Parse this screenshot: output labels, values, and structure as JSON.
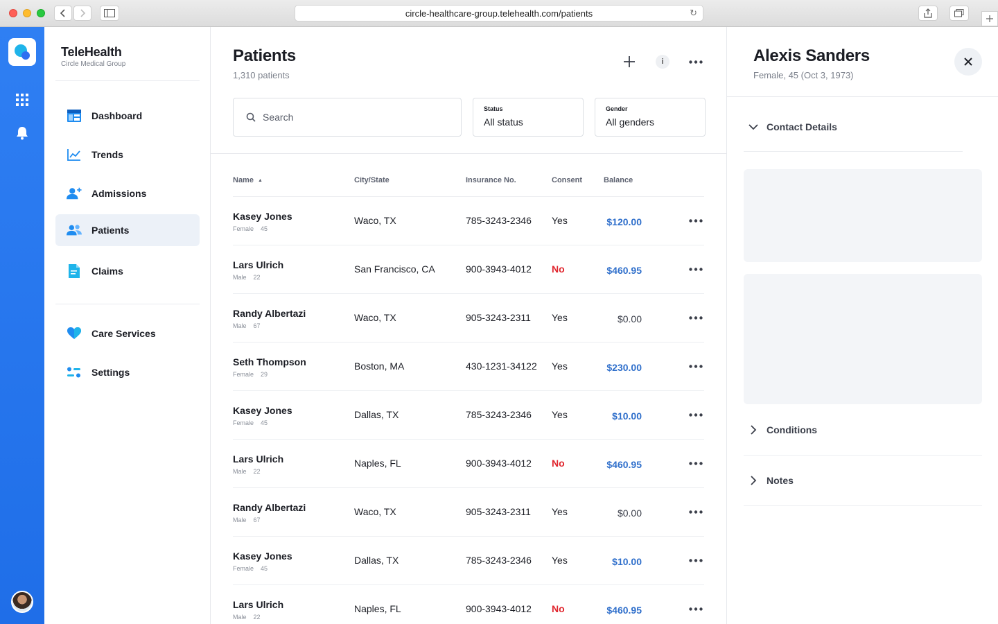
{
  "browser": {
    "url": "circle-healthcare-group.telehealth.com/patients"
  },
  "brand": {
    "title": "TeleHealth",
    "subtitle": "Circle Medical Group"
  },
  "nav": {
    "primary": [
      {
        "label": "Dashboard",
        "icon": "dashboard-icon"
      },
      {
        "label": "Trends",
        "icon": "trends-icon"
      },
      {
        "label": "Admissions",
        "icon": "add-user-icon"
      },
      {
        "label": "Patients",
        "icon": "patients-icon",
        "active": true
      },
      {
        "label": "Claims",
        "icon": "document-icon"
      }
    ],
    "secondary": [
      {
        "label": "Care Services",
        "icon": "heart-icon"
      },
      {
        "label": "Settings",
        "icon": "settings-icon"
      }
    ]
  },
  "page": {
    "title": "Patients",
    "count": "1,310 patients"
  },
  "search": {
    "placeholder": "Search"
  },
  "filters": {
    "status": {
      "label": "Status",
      "value": "All status"
    },
    "gender": {
      "label": "Gender",
      "value": "All genders"
    }
  },
  "table": {
    "columns": {
      "name": "Name",
      "sort_indicator": "▲",
      "city": "City/State",
      "insurance": "Insurance No.",
      "consent": "Consent",
      "balance": "Balance"
    },
    "rows": [
      {
        "name": "Kasey Jones",
        "gender": "Female",
        "age": "45",
        "city": "Waco, TX",
        "insurance": "785-3243-2346",
        "consent": "Yes",
        "balance": "$120.00"
      },
      {
        "name": "Lars Ulrich",
        "gender": "Male",
        "age": "22",
        "city": "San Francisco, CA",
        "insurance": "900-3943-4012",
        "consent": "No",
        "balance": "$460.95"
      },
      {
        "name": "Randy Albertazi",
        "gender": "Male",
        "age": "67",
        "city": "Waco, TX",
        "insurance": "905-3243-2311",
        "consent": "Yes",
        "balance": "$0.00"
      },
      {
        "name": "Seth Thompson",
        "gender": "Female",
        "age": "29",
        "city": "Boston, MA",
        "insurance": "430-1231-34122",
        "consent": "Yes",
        "balance": "$230.00"
      },
      {
        "name": "Kasey Jones",
        "gender": "Female",
        "age": "45",
        "city": "Dallas, TX",
        "insurance": "785-3243-2346",
        "consent": "Yes",
        "balance": "$10.00"
      },
      {
        "name": "Lars Ulrich",
        "gender": "Male",
        "age": "22",
        "city": "Naples, FL",
        "insurance": "900-3943-4012",
        "consent": "No",
        "balance": "$460.95"
      },
      {
        "name": "Randy Albertazi",
        "gender": "Male",
        "age": "67",
        "city": "Waco, TX",
        "insurance": "905-3243-2311",
        "consent": "Yes",
        "balance": "$0.00"
      },
      {
        "name": "Kasey Jones",
        "gender": "Female",
        "age": "45",
        "city": "Dallas, TX",
        "insurance": "785-3243-2346",
        "consent": "Yes",
        "balance": "$10.00"
      },
      {
        "name": "Lars Ulrich",
        "gender": "Male",
        "age": "22",
        "city": "Naples, FL",
        "insurance": "900-3943-4012",
        "consent": "No",
        "balance": "$460.95"
      }
    ]
  },
  "detail": {
    "name": "Alexis Sanders",
    "subtitle": "Female, 45 (Oct 3, 1973)",
    "sections": {
      "contact": "Contact Details",
      "conditions": "Conditions",
      "notes": "Notes"
    }
  },
  "colors": {
    "rail": "#2f7ff3",
    "accent": "#2f6fcb",
    "danger": "#e0252d",
    "active_nav": "#ecf1f8"
  }
}
